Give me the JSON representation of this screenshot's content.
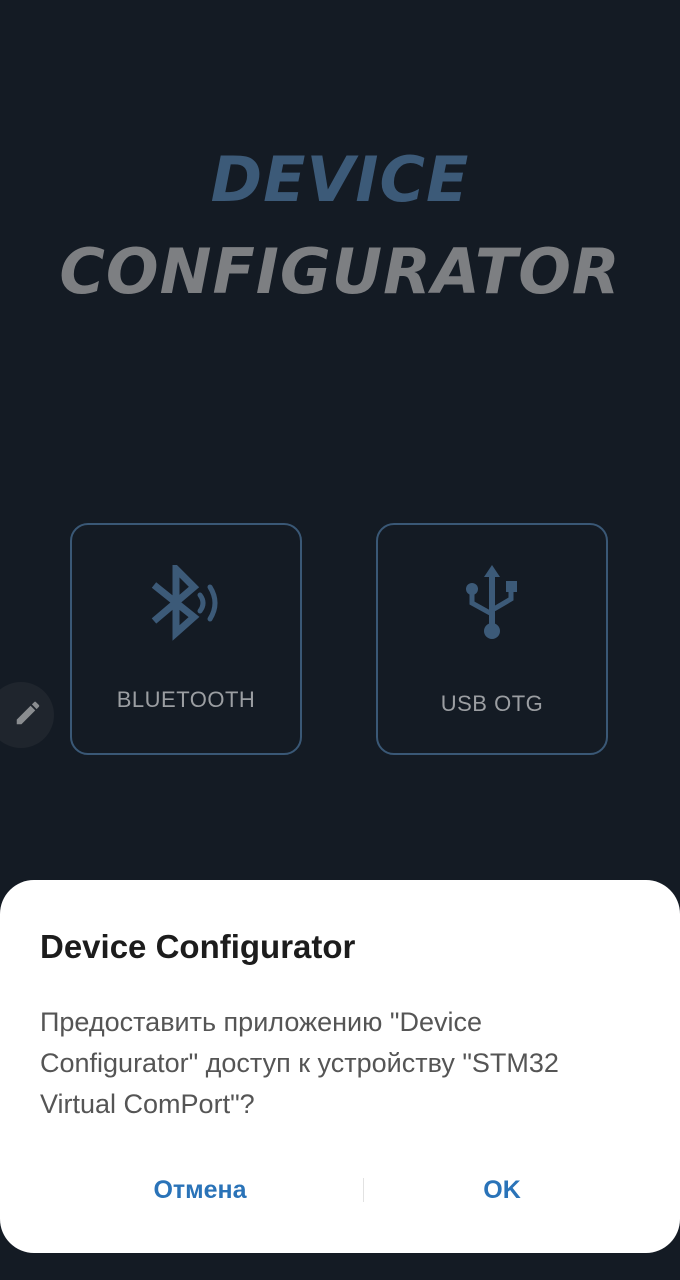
{
  "app": {
    "title_line1": "DEVICE",
    "title_line2": "CONFIGURATOR"
  },
  "connections": [
    {
      "label": "BLUETOOTH",
      "icon": "bluetooth-audio-icon"
    },
    {
      "label": "USB OTG",
      "icon": "usb-icon"
    }
  ],
  "fab": {
    "icon": "pencil-icon"
  },
  "dialog": {
    "title": "Device Configurator",
    "message": "Предоставить приложению \"Device Configurator\" доступ к устройству \"STM32 Virtual ComPort\"?",
    "cancel_label": "Отмена",
    "ok_label": "OK"
  },
  "colors": {
    "background": "#141b24",
    "accent_blue": "#3c5a78",
    "title_gray": "#7d7f82",
    "dialog_button": "#2a73b8"
  }
}
